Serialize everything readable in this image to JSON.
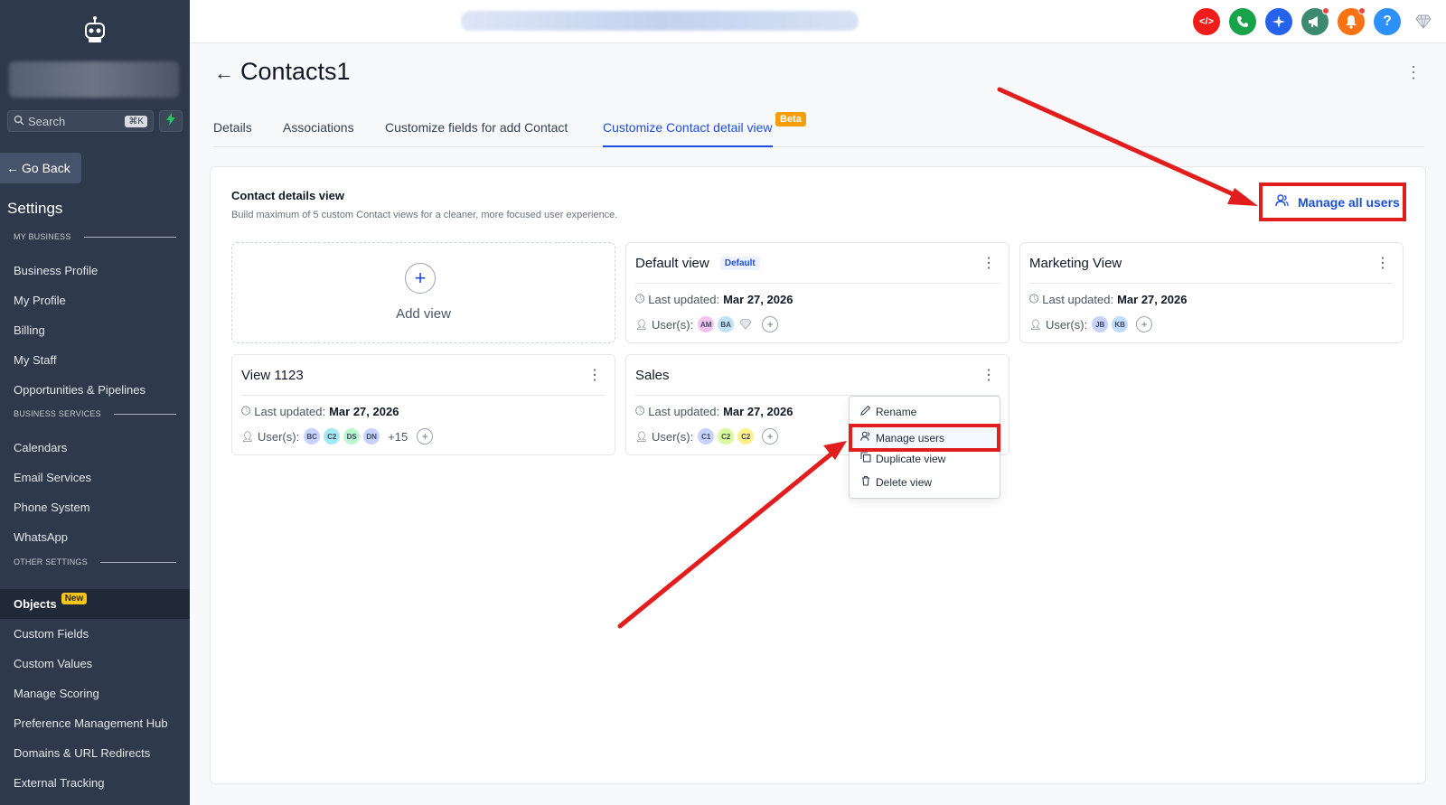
{
  "sidebar": {
    "search_placeholder": "Search",
    "search_shortcut": "⌘K",
    "go_back": "Go Back",
    "title": "Settings",
    "sections": {
      "my_business": "MY BUSINESS",
      "business_services": "BUSINESS SERVICES",
      "other_settings": "OTHER SETTINGS"
    },
    "items": {
      "business_profile": "Business Profile",
      "my_profile": "My Profile",
      "billing": "Billing",
      "my_staff": "My Staff",
      "opportunities": "Opportunities & Pipelines",
      "calendars": "Calendars",
      "email_services": "Email Services",
      "phone_system": "Phone System",
      "whatsapp": "WhatsApp",
      "objects": "Objects",
      "objects_badge": "New",
      "custom_fields": "Custom Fields",
      "custom_values": "Custom Values",
      "manage_scoring": "Manage Scoring",
      "preference_hub": "Preference Management Hub",
      "domains": "Domains & URL Redirects",
      "external_tracking": "External Tracking"
    }
  },
  "topbar": {
    "icons": [
      {
        "name": "code-icon",
        "color": "#ef1c1c",
        "glyph": "</>"
      },
      {
        "name": "phone-icon",
        "color": "#16a34a",
        "glyph": "✆"
      },
      {
        "name": "sparkle-icon",
        "color": "#2563eb",
        "glyph": "✦"
      },
      {
        "name": "megaphone-icon",
        "color": "#3d8a6e",
        "glyph": "📢"
      },
      {
        "name": "bell-icon",
        "color": "#f97316",
        "glyph": "🔔"
      },
      {
        "name": "help-icon",
        "color": "#2e90fa",
        "glyph": "?"
      }
    ]
  },
  "header": {
    "title": "Contacts1"
  },
  "tabs": {
    "details": "Details",
    "associations": "Associations",
    "customize_fields": "Customize fields for add Contact",
    "customize_view": "Customize Contact detail view",
    "beta": "Beta"
  },
  "panel": {
    "title": "Contact details view",
    "subtitle": "Build maximum of 5 custom Contact views for a cleaner, more focused user experience.",
    "manage_all_users": "Manage all users",
    "add_view": "Add view",
    "last_updated_label": "Last updated:",
    "users_label": "User(s):",
    "default_tag": "Default",
    "cards": {
      "default_view": {
        "title": "Default view",
        "date": "Mar 27, 2026",
        "avatars": [
          "AM",
          "BA"
        ]
      },
      "marketing_view": {
        "title": "Marketing View",
        "date": "Mar 27, 2026",
        "avatars": [
          "JB",
          "KB"
        ]
      },
      "view_1123": {
        "title": "View 1123",
        "date": "Mar 27, 2026",
        "avatars": [
          "BC",
          "C2",
          "DS",
          "DN"
        ],
        "more": "+15"
      },
      "sales": {
        "title": "Sales",
        "date": "Mar 27, 2026",
        "avatars": [
          "C1",
          "C2",
          "C2"
        ]
      }
    }
  },
  "dropdown": {
    "rename": "Rename",
    "manage_users": "Manage users",
    "duplicate_view": "Duplicate view",
    "delete_view": "Delete view"
  },
  "colors": {
    "accent": "#1d4ed8",
    "annotation_red": "#e11d1d",
    "sidebar_bg": "#2e3a4b"
  }
}
